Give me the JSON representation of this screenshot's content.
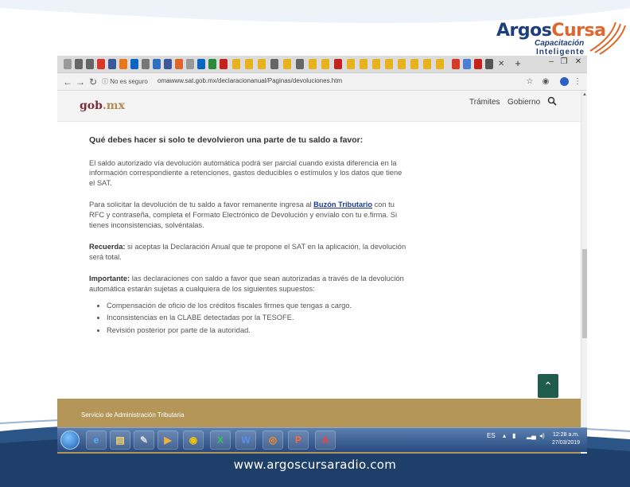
{
  "brand": {
    "name_part1": "Argos",
    "name_part2": "Cursa",
    "tagline1": "Capacitación",
    "tagline2": "Inteligente",
    "website": "www.argoscursaradio.com"
  },
  "colors": {
    "brand_blue": "#1d3f7a",
    "brand_orange": "#e0652a",
    "gob_logo": "#7b2d3b",
    "footer_gold": "#b39658",
    "link_blue": "#1a3a9a",
    "back_to_top": "#1f5c4a"
  },
  "browser": {
    "security_label": "No es seguro",
    "url": "omawww.sat.gob.mx/declaracionanual/Paginas/devoluciones.htm",
    "tab_close_icon": "close-icon",
    "new_tab_icon": "plus-icon"
  },
  "site": {
    "logo_main": "gob",
    "logo_suffix": ".mx",
    "menu": [
      "Trámites",
      "Gobierno"
    ]
  },
  "article": {
    "heading": "Qué debes hacer si solo te devolvieron una parte de tu saldo a favor:",
    "p1": "El saldo autorizado vía devolución automática podrá ser parcial cuando exista diferencia en la información correspondiente a retenciones, gastos deducibles o estímulos y los datos que tiene el SAT.",
    "p2_before": "Para solicitar la devolución de tu saldo a favor remanente ingresa al ",
    "p2_link": "Buzón Tributario",
    "p2_after": " con tu RFC y contraseña, completa el Formato Electrónico de Devolución y envíalo con tu e.firma. Si tienes inconsistencias, solvéntalas.",
    "p3_label": "Recuerda:",
    "p3_text": " si aceptas la Declaración Anual que te propone el SAT en la aplicación, la devolución será total.",
    "p4_label": "Importante:",
    "p4_text": " las declaraciones con saldo a favor que sean autorizadas a través de la devolución automática estarán sujetas a cualquiera de los siguientes supuestos:",
    "bullets": [
      "Compensación de oficio de los créditos fiscales firmes que tengas a cargo.",
      "Inconsistencias en la CLABE detectadas por la TESOFE.",
      "Revisión posterior por parte de la autoridad."
    ]
  },
  "page_footer": {
    "text": "Servicio de Administración Tributaria"
  },
  "taskbar": {
    "language": "ES",
    "time": "12:28 a.m.",
    "date": "27/03/2019"
  }
}
